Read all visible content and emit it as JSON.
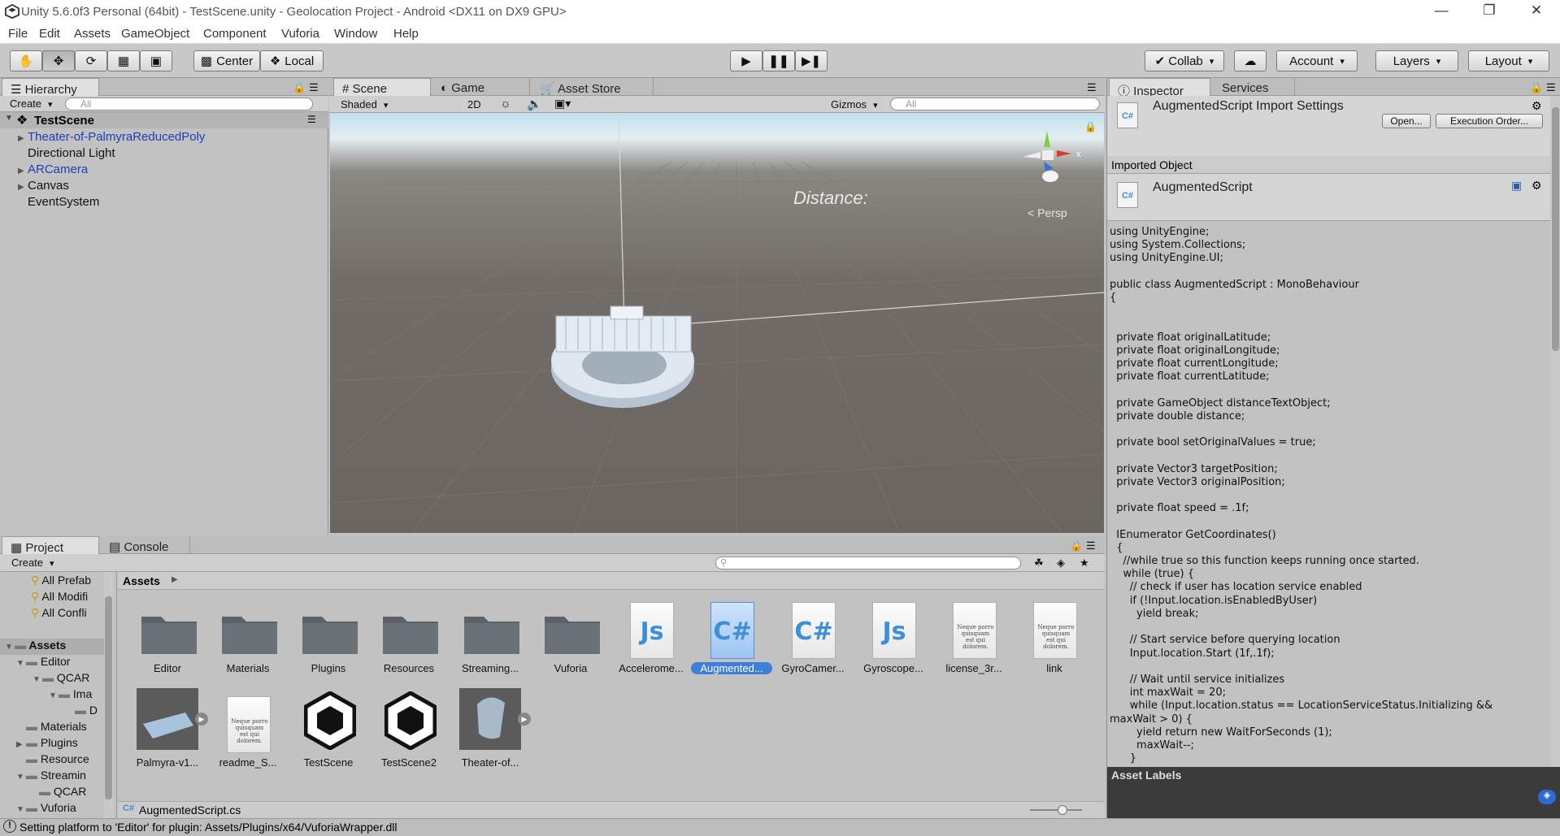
{
  "window": {
    "title": "Unity 5.6.0f3 Personal (64bit) - TestScene.unity - Geolocation Project - Android <DX11 on DX9 GPU>"
  },
  "menu": [
    "File",
    "Edit",
    "Assets",
    "GameObject",
    "Component",
    "Vuforia",
    "Window",
    "Help"
  ],
  "toolbar": {
    "center": "Center",
    "local": "Local",
    "collab": "Collab",
    "account": "Account",
    "layers": "Layers",
    "layout": "Layout"
  },
  "hierarchy": {
    "tab": "Hierarchy",
    "create": "Create",
    "search_placeholder": "All",
    "scene": "TestScene",
    "items": [
      "Theater-of-PalmyraReducedPoly",
      "Directional Light",
      "ARCamera",
      "Canvas",
      "EventSystem"
    ]
  },
  "scene": {
    "tab_scene": "Scene",
    "tab_game": "Game",
    "tab_store": "Asset Store",
    "shading": "Shaded",
    "mode2d": "2D",
    "gizmos": "Gizmos",
    "search_placeholder": "All",
    "persp": "Persp",
    "distance_text": "Distance:"
  },
  "inspector": {
    "tab": "Inspector",
    "tab_services": "Services",
    "import_title": "AugmentedScript Import Settings",
    "open_btn": "Open...",
    "exec_btn": "Execution Order...",
    "imported_object": "Imported Object",
    "script_name": "AugmentedScript",
    "asset_labels": "Asset Labels",
    "code": "using UnityEngine;\nusing System.Collections;\nusing UnityEngine.UI;\n\npublic class AugmentedScript : MonoBehaviour\n{\n\n\n  private float originalLatitude;\n  private float originalLongitude;\n  private float currentLongitude;\n  private float currentLatitude;\n\n  private GameObject distanceTextObject;\n  private double distance;\n\n  private bool setOriginalValues = true;\n\n  private Vector3 targetPosition;\n  private Vector3 originalPosition;\n\n  private float speed = .1f;\n\n  IEnumerator GetCoordinates()\n  {\n    //while true so this function keeps running once started.\n    while (true) {\n      // check if user has location service enabled\n      if (!Input.location.isEnabledByUser)\n        yield break;\n\n      // Start service before querying location\n      Input.location.Start (1f,.1f);\n\n      // Wait until service initializes\n      int maxWait = 20;\n      while (Input.location.status == LocationServiceStatus.Initializing &&\nmaxWait > 0) {\n        yield return new WaitForSeconds (1);\n        maxWait--;\n      }"
  },
  "project": {
    "tab": "Project",
    "tab_console": "Console",
    "create": "Create",
    "assets_crumb": "Assets",
    "favorites": [
      "All Prefab",
      "All Modifi",
      "All Confli"
    ],
    "tree": [
      "Assets",
      "Editor",
      "QCAR",
      "Ima",
      "D",
      "Materials",
      "Plugins",
      "Resource",
      "Streamin",
      "QCAR",
      "Vuforia"
    ],
    "assets": [
      "Editor",
      "Materials",
      "Plugins",
      "Resources",
      "Streaming...",
      "Vuforia",
      "Accelerome...",
      "Augmented...",
      "GyroCamer...",
      "Gyroscope...",
      "license_3r...",
      "link",
      "Palmyra-v1...",
      "readme_S...",
      "TestScene",
      "TestScene2",
      "Theater-of..."
    ],
    "doc_snippet": "Neque porro quisquam est qui dolorem.",
    "selected_file": "AugmentedScript.cs"
  },
  "status": {
    "message": "Setting platform to 'Editor' for plugin: Assets/Plugins/x64/VuforiaWrapper.dll"
  },
  "colors": {
    "selection": "#3d7fd9",
    "hier_blue": "#1a3fb8"
  }
}
